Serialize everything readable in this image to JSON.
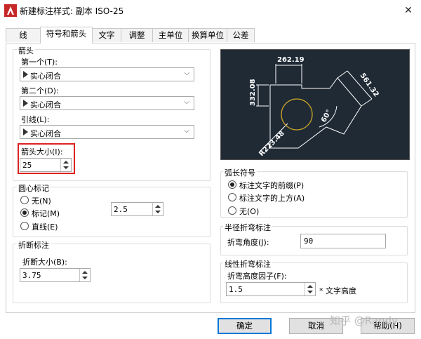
{
  "window": {
    "title": "新建标注样式: 副本 ISO-25",
    "close_symbol": "✕"
  },
  "tabs": [
    "线",
    "符号和箭头",
    "文字",
    "调整",
    "主单位",
    "换算单位",
    "公差"
  ],
  "arrowheads": {
    "group_title": "箭头",
    "first_label": "第一个(T):",
    "first_value": "实心闭合",
    "second_label": "第二个(D):",
    "second_value": "实心闭合",
    "leader_label": "引线(L):",
    "leader_value": "实心闭合",
    "size_label": "箭头大小(I):",
    "size_value": "25"
  },
  "center_marks": {
    "group_title": "圆心标记",
    "none_label": "无(N)",
    "mark_label": "标记(M)",
    "line_label": "直线(E)",
    "selected": "mark",
    "size_value": "2.5"
  },
  "dimension_break": {
    "group_title": "折断标注",
    "size_label": "折断大小(B):",
    "size_value": "3.75"
  },
  "preview": {
    "dim_top": "262.19",
    "dim_left": "332.08",
    "dim_right": "561.32",
    "dim_radius": "R223.48",
    "dim_angle": "60°"
  },
  "arc_length": {
    "group_title": "弧长符号",
    "opt1": "标注文字的前缀(P)",
    "opt2": "标注文字的上方(A)",
    "opt3": "无(O)",
    "selected": "opt1"
  },
  "radius_jog": {
    "group_title": "半径折弯标注",
    "angle_label": "折弯角度(J):",
    "angle_value": "90"
  },
  "linear_jog": {
    "group_title": "线性折弯标注",
    "factor_label": "折弯高度因子(F):",
    "factor_value": "1.5",
    "suffix": "* 文字高度"
  },
  "buttons": {
    "ok": "确定",
    "cancel": "取消",
    "help": "帮助(H)"
  },
  "watermark": "知乎 @Randy",
  "colors": {
    "preview_bg": "#1f2a35",
    "preview_lines": "#ffffff",
    "preview_circle": "#c9a227",
    "highlight": "#dd2222",
    "accent": "#0078d7",
    "app_icon": "#d32f2f"
  }
}
